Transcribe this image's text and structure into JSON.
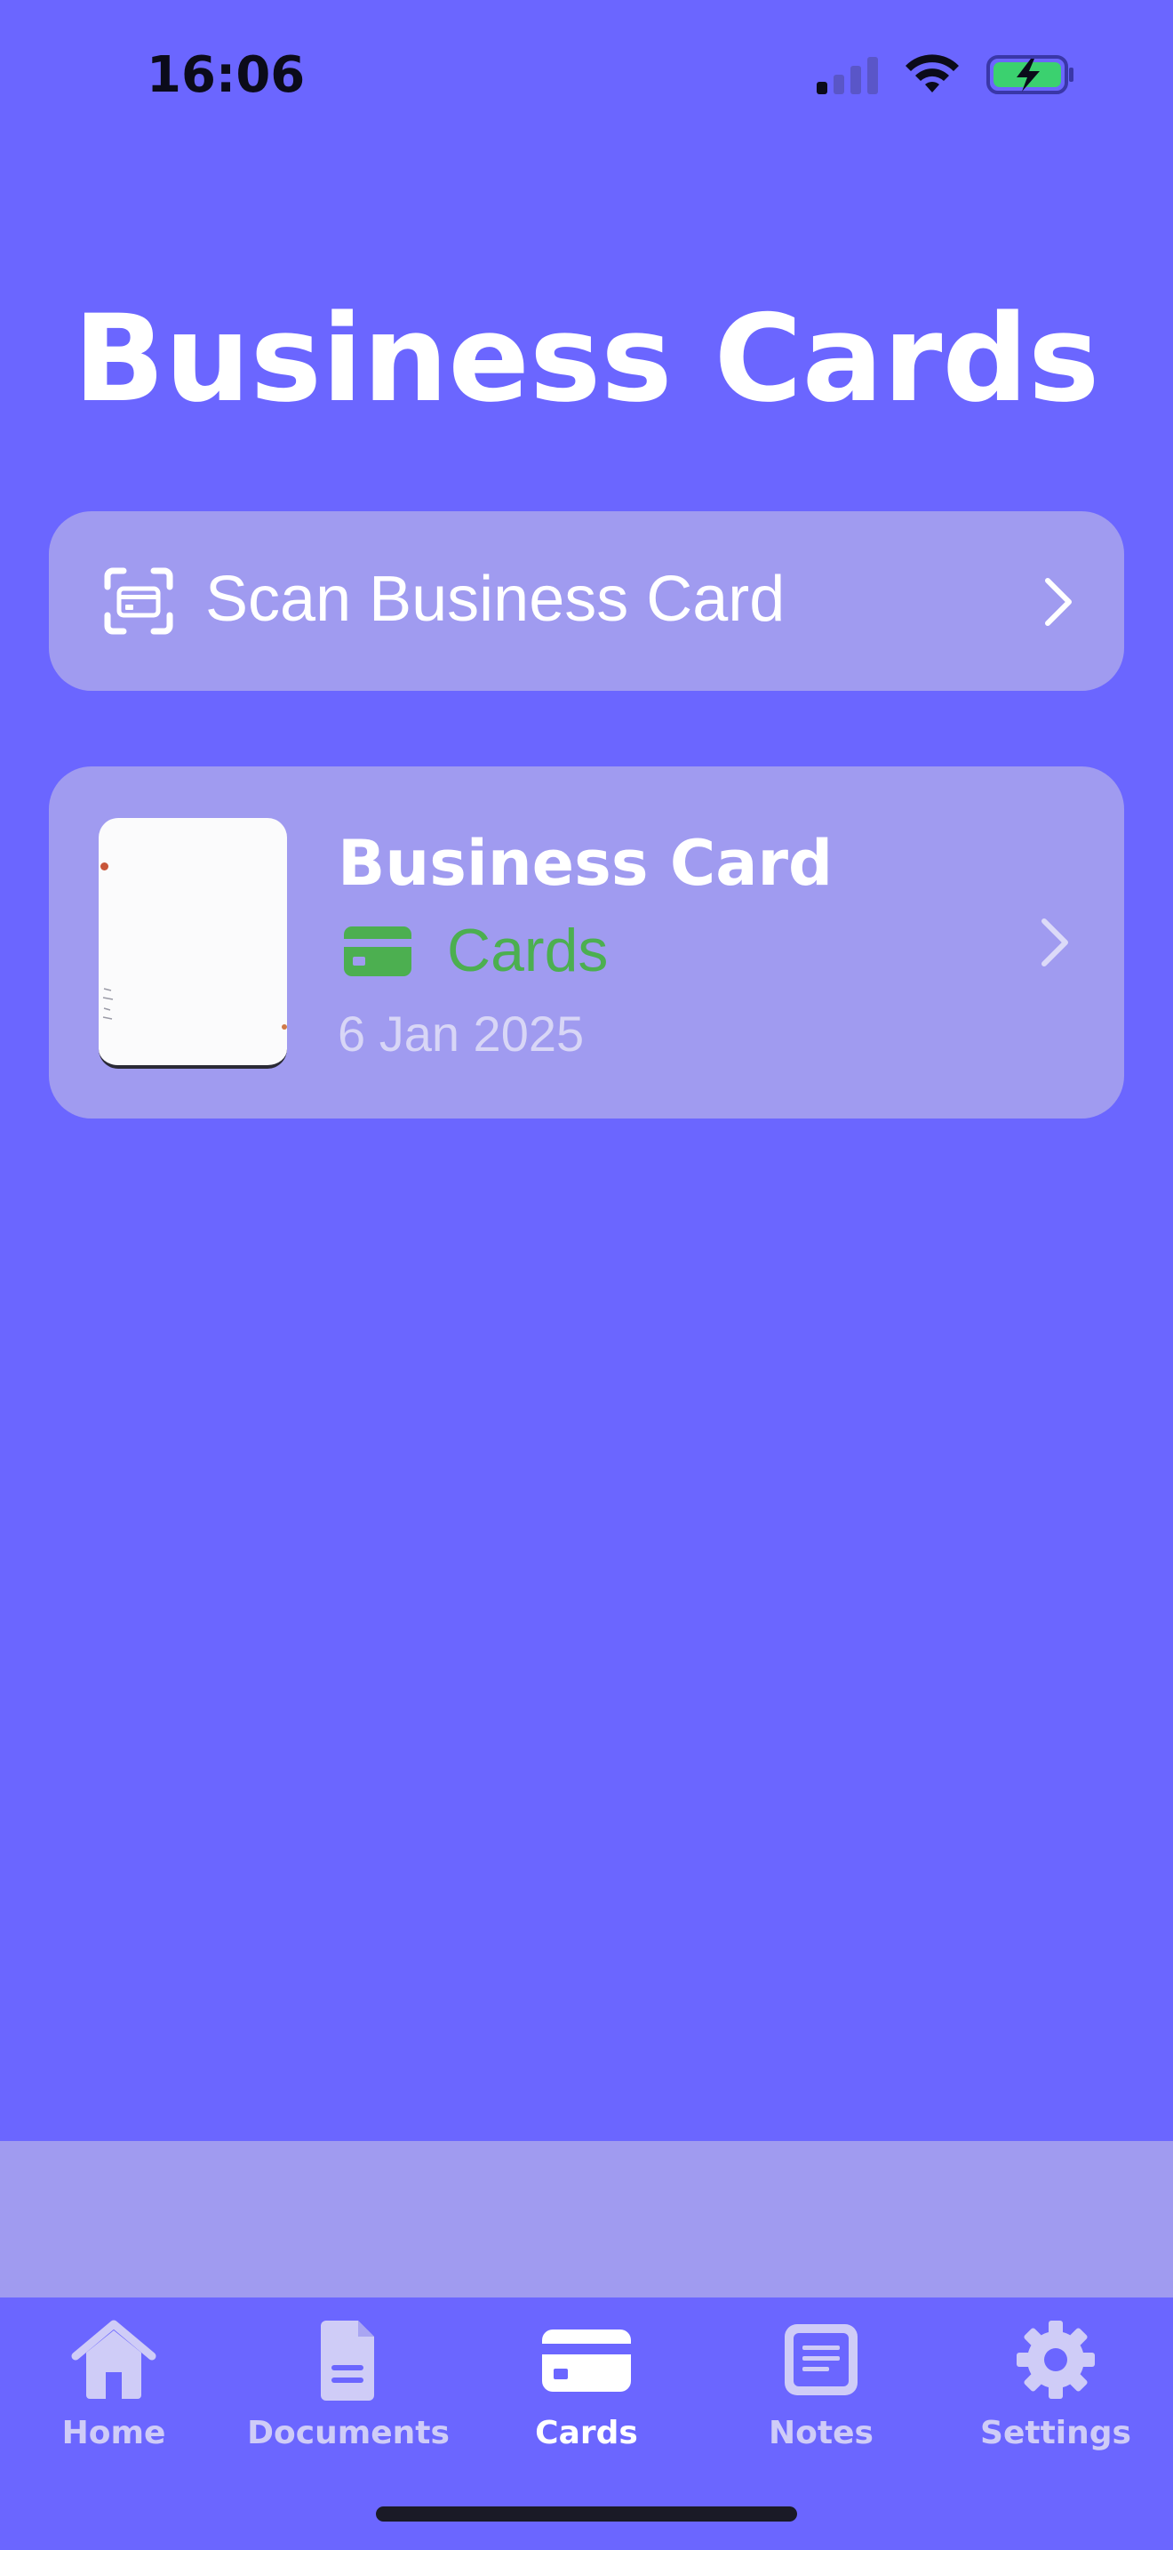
{
  "status_bar": {
    "time": "16:06"
  },
  "page": {
    "title": "Business Cards"
  },
  "scan_action": {
    "label": "Scan Business Card",
    "icon": "scan-card-icon"
  },
  "cards": [
    {
      "title": "Business Card",
      "category": "Cards",
      "category_icon": "credit-card-icon",
      "date": "6 Jan 2025"
    }
  ],
  "tab_bar": {
    "tabs": [
      {
        "label": "Home",
        "icon": "home-icon",
        "active": false
      },
      {
        "label": "Documents",
        "icon": "document-icon",
        "active": false
      },
      {
        "label": "Cards",
        "icon": "credit-card-icon",
        "active": true
      },
      {
        "label": "Notes",
        "icon": "notes-icon",
        "active": false
      },
      {
        "label": "Settings",
        "icon": "gear-icon",
        "active": false
      }
    ]
  },
  "colors": {
    "background": "#6B66FF",
    "card_background": "#A09BF0",
    "category_green": "#4CAF50",
    "tab_inactive": "#CFCCF7",
    "tab_active": "#FFFFFF"
  }
}
